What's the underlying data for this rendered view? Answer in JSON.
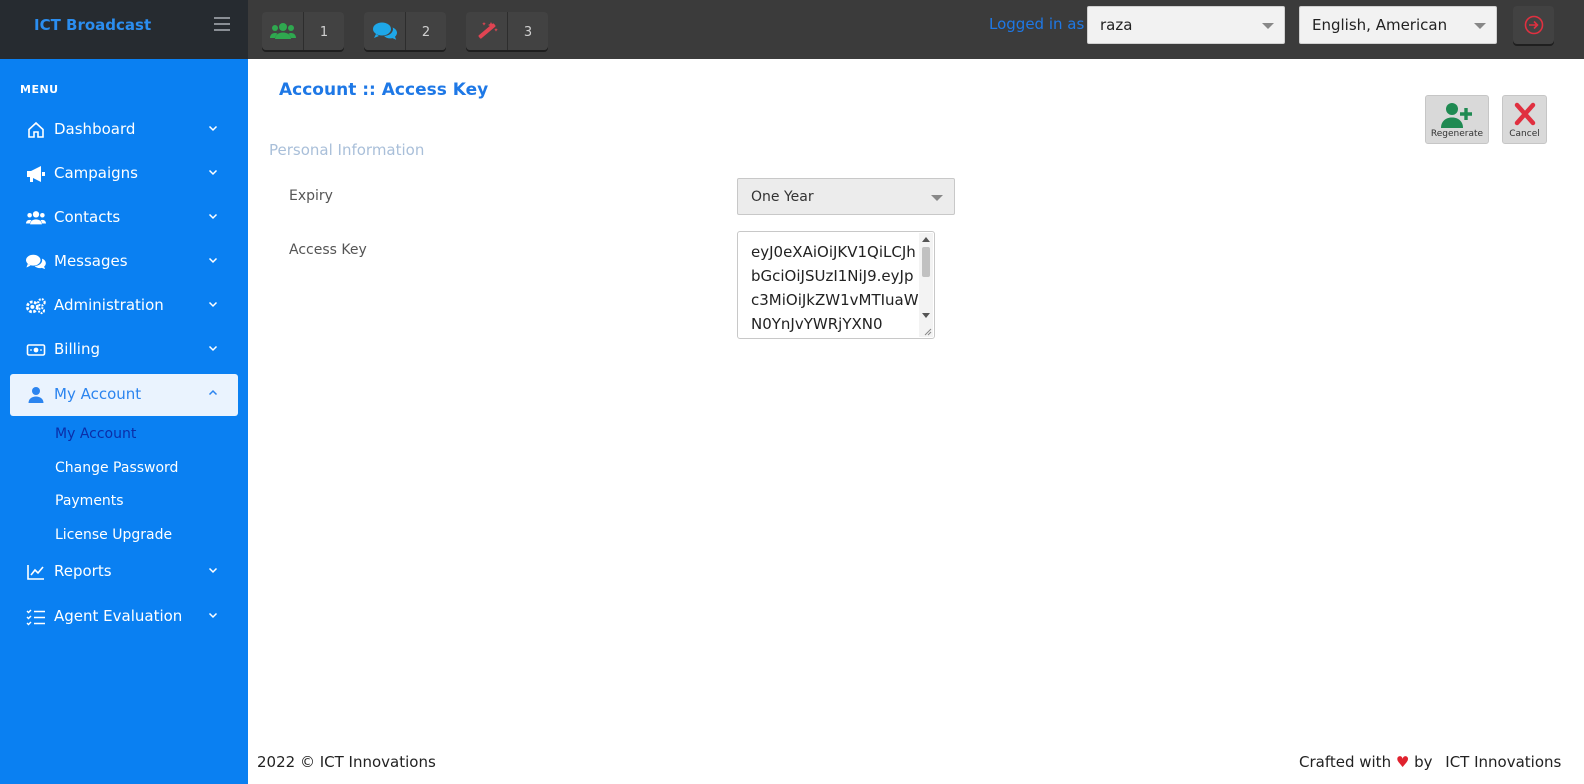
{
  "app": {
    "title": "ICT Broadcast"
  },
  "topbar": {
    "quick_buttons": [
      {
        "icon": "users-icon",
        "count": "1",
        "color": "#2fa84f"
      },
      {
        "icon": "chat-icon",
        "count": "2",
        "color": "#1ea7e8"
      },
      {
        "icon": "magic-wand-icon",
        "count": "3",
        "color": "#e04452"
      }
    ],
    "logged_in_label": "Logged in as :",
    "user_select": "raza",
    "language_select": "English, American"
  },
  "sidebar": {
    "menu_title": "MENU",
    "items": [
      {
        "label": "Dashboard",
        "icon": "home-icon"
      },
      {
        "label": "Campaigns",
        "icon": "megaphone-icon"
      },
      {
        "label": "Contacts",
        "icon": "users-icon"
      },
      {
        "label": "Messages",
        "icon": "chat-icon"
      },
      {
        "label": "Administration",
        "icon": "gears-icon"
      },
      {
        "label": "Billing",
        "icon": "money-icon"
      },
      {
        "label": "My Account",
        "icon": "user-icon"
      },
      {
        "label": "Reports",
        "icon": "chart-line-icon"
      },
      {
        "label": "Agent Evaluation",
        "icon": "checklist-icon"
      }
    ],
    "sub_items": [
      "My Account",
      "Change Password",
      "Payments",
      "License Upgrade"
    ]
  },
  "main": {
    "page_title": "Account :: Access Key",
    "section_title": "Personal Information",
    "expiry_label": "Expiry",
    "expiry_value": "One Year",
    "access_key_label": "Access Key",
    "access_key_value": "eyJ0eXAiOiJKV1QiLCJhbGciOiJSUzI1NiJ9.eyJpc3MiOiJkZW1vMTIuaWN0YnJvYWRjYXN0",
    "regenerate_label": "Regenerate",
    "cancel_label": "Cancel"
  },
  "footer": {
    "left": "2022 © ICT Innovations",
    "crafted": "Crafted with",
    "by": "by",
    "company": "ICT Innovations"
  },
  "colors": {
    "accent": "#0a80f2",
    "title": "#1e78e6",
    "regenerate": "#1f8a52",
    "cancel": "#e03040"
  }
}
